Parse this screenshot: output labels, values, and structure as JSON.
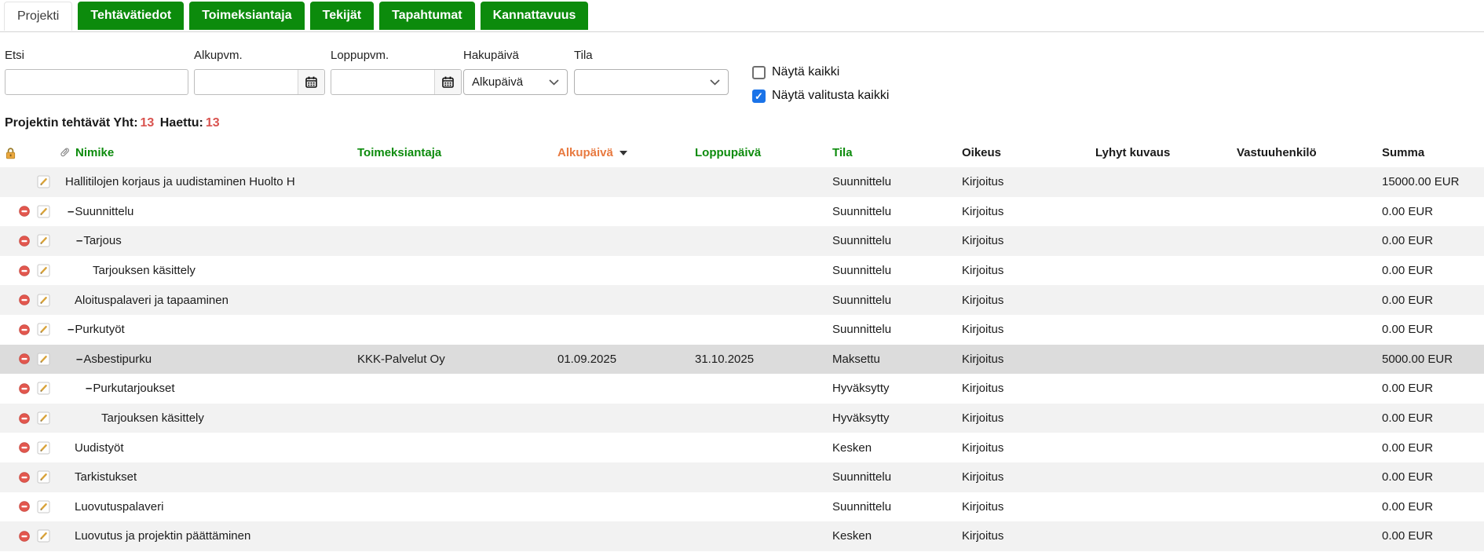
{
  "tabs": {
    "items": [
      {
        "label": "Projekti",
        "active": true
      },
      {
        "label": "Tehtävätiedot",
        "active": false
      },
      {
        "label": "Toimeksiantaja",
        "active": false
      },
      {
        "label": "Tekijät",
        "active": false
      },
      {
        "label": "Tapahtumat",
        "active": false
      },
      {
        "label": "Kannattavuus",
        "active": false
      }
    ]
  },
  "filters": {
    "etsi": {
      "label": "Etsi",
      "value": "",
      "placeholder": ""
    },
    "alkupvm": {
      "label": "Alkupvm.",
      "value": "",
      "placeholder": ""
    },
    "loppupvm": {
      "label": "Loppupvm.",
      "value": "",
      "placeholder": ""
    },
    "hakupaiva": {
      "label": "Hakupäivä",
      "selected": "Alkupäivä"
    },
    "tila": {
      "label": "Tila",
      "selected": ""
    },
    "nayta_kaikki": {
      "label": "Näytä kaikki",
      "checked": false
    },
    "nayta_valitusta_kaikki": {
      "label": "Näytä valitusta kaikki",
      "checked": true
    }
  },
  "summary": {
    "label_total": "Projektin tehtävät Yht:",
    "total": "13",
    "label_fetched": "Haettu:",
    "fetched": "13"
  },
  "table": {
    "columns": [
      {
        "key": "nimike",
        "label": "Nimike",
        "color": "#0c8b0c"
      },
      {
        "key": "toimeksiantaja",
        "label": "Toimeksiantaja",
        "color": "#0c8b0c"
      },
      {
        "key": "alkupaiva",
        "label": "Alkupäivä",
        "color": "#e8793f",
        "sort": "desc"
      },
      {
        "key": "loppupaiva",
        "label": "Loppupäivä",
        "color": "#0c8b0c"
      },
      {
        "key": "tila",
        "label": "Tila",
        "color": "#0c8b0c"
      },
      {
        "key": "oikeus",
        "label": "Oikeus",
        "color": "#1a1a1a"
      },
      {
        "key": "lyhyt_kuvaus",
        "label": "Lyhyt kuvaus",
        "color": "#1a1a1a"
      },
      {
        "key": "vastuuhenkilo",
        "label": "Vastuuhenkilö",
        "color": "#1a1a1a"
      },
      {
        "key": "summa",
        "label": "Summa",
        "color": "#1a1a1a"
      }
    ],
    "rows": [
      {
        "nimike": "Hallitilojen korjaus ja uudistaminen Huolto H",
        "level": 0,
        "has_children": false,
        "deletable": false,
        "selected": false,
        "toimeksiantaja": "",
        "alkupaiva": "",
        "loppupaiva": "",
        "tila": "Suunnittelu",
        "oikeus": "Kirjoitus",
        "lyhyt_kuvaus": "",
        "vastuuhenkilo": "",
        "summa": "15000.00 EUR"
      },
      {
        "nimike": "Suunnittelu",
        "level": 1,
        "has_children": true,
        "deletable": true,
        "selected": false,
        "toimeksiantaja": "",
        "alkupaiva": "",
        "loppupaiva": "",
        "tila": "Suunnittelu",
        "oikeus": "Kirjoitus",
        "lyhyt_kuvaus": "",
        "vastuuhenkilo": "",
        "summa": "0.00 EUR"
      },
      {
        "nimike": "Tarjous",
        "level": 2,
        "has_children": true,
        "deletable": true,
        "selected": false,
        "toimeksiantaja": "",
        "alkupaiva": "",
        "loppupaiva": "",
        "tila": "Suunnittelu",
        "oikeus": "Kirjoitus",
        "lyhyt_kuvaus": "",
        "vastuuhenkilo": "",
        "summa": "0.00 EUR"
      },
      {
        "nimike": "Tarjouksen käsittely",
        "level": 3,
        "has_children": false,
        "deletable": true,
        "selected": false,
        "toimeksiantaja": "",
        "alkupaiva": "",
        "loppupaiva": "",
        "tila": "Suunnittelu",
        "oikeus": "Kirjoitus",
        "lyhyt_kuvaus": "",
        "vastuuhenkilo": "",
        "summa": "0.00 EUR"
      },
      {
        "nimike": "Aloituspalaveri ja tapaaminen",
        "level": 1,
        "has_children": false,
        "deletable": true,
        "selected": false,
        "toimeksiantaja": "",
        "alkupaiva": "",
        "loppupaiva": "",
        "tila": "Suunnittelu",
        "oikeus": "Kirjoitus",
        "lyhyt_kuvaus": "",
        "vastuuhenkilo": "",
        "summa": "0.00 EUR"
      },
      {
        "nimike": "Purkutyöt",
        "level": 1,
        "has_children": true,
        "deletable": true,
        "selected": false,
        "toimeksiantaja": "",
        "alkupaiva": "",
        "loppupaiva": "",
        "tila": "Suunnittelu",
        "oikeus": "Kirjoitus",
        "lyhyt_kuvaus": "",
        "vastuuhenkilo": "",
        "summa": "0.00 EUR"
      },
      {
        "nimike": "Asbestipurku",
        "level": 2,
        "has_children": true,
        "deletable": true,
        "selected": true,
        "toimeksiantaja": "KKK-Palvelut Oy",
        "alkupaiva": "01.09.2025",
        "loppupaiva": "31.10.2025",
        "tila": "Maksettu",
        "oikeus": "Kirjoitus",
        "lyhyt_kuvaus": "",
        "vastuuhenkilo": "",
        "summa": "5000.00 EUR"
      },
      {
        "nimike": "Purkutarjoukset",
        "level": 3,
        "has_children": true,
        "deletable": true,
        "selected": false,
        "toimeksiantaja": "",
        "alkupaiva": "",
        "loppupaiva": "",
        "tila": "Hyväksytty",
        "oikeus": "Kirjoitus",
        "lyhyt_kuvaus": "",
        "vastuuhenkilo": "",
        "summa": "0.00 EUR"
      },
      {
        "nimike": "Tarjouksen käsittely",
        "level": 4,
        "has_children": false,
        "deletable": true,
        "selected": false,
        "toimeksiantaja": "",
        "alkupaiva": "",
        "loppupaiva": "",
        "tila": "Hyväksytty",
        "oikeus": "Kirjoitus",
        "lyhyt_kuvaus": "",
        "vastuuhenkilo": "",
        "summa": "0.00 EUR"
      },
      {
        "nimike": "Uudistyöt",
        "level": 1,
        "has_children": false,
        "deletable": true,
        "selected": false,
        "toimeksiantaja": "",
        "alkupaiva": "",
        "loppupaiva": "",
        "tila": "Kesken",
        "oikeus": "Kirjoitus",
        "lyhyt_kuvaus": "",
        "vastuuhenkilo": "",
        "summa": "0.00 EUR"
      },
      {
        "nimike": "Tarkistukset",
        "level": 1,
        "has_children": false,
        "deletable": true,
        "selected": false,
        "toimeksiantaja": "",
        "alkupaiva": "",
        "loppupaiva": "",
        "tila": "Suunnittelu",
        "oikeus": "Kirjoitus",
        "lyhyt_kuvaus": "",
        "vastuuhenkilo": "",
        "summa": "0.00 EUR"
      },
      {
        "nimike": "Luovutuspalaveri",
        "level": 1,
        "has_children": false,
        "deletable": true,
        "selected": false,
        "toimeksiantaja": "",
        "alkupaiva": "",
        "loppupaiva": "",
        "tila": "Suunnittelu",
        "oikeus": "Kirjoitus",
        "lyhyt_kuvaus": "",
        "vastuuhenkilo": "",
        "summa": "0.00 EUR"
      },
      {
        "nimike": "Luovutus ja projektin päättäminen",
        "level": 1,
        "has_children": false,
        "deletable": true,
        "selected": false,
        "toimeksiantaja": "",
        "alkupaiva": "",
        "loppupaiva": "",
        "tila": "Kesken",
        "oikeus": "Kirjoitus",
        "lyhyt_kuvaus": "",
        "vastuuhenkilo": "",
        "summa": "0.00 EUR"
      }
    ]
  },
  "icons": {
    "lock": "lock-icon",
    "attachment": "paperclip-icon",
    "delete": "delete-icon",
    "edit": "edit-pencil-icon",
    "calendar": "calendar-icon",
    "chevron": "chevron-down-icon",
    "sort": "sort-desc-arrow",
    "check": "✓",
    "collapse_glyph": "–"
  },
  "colors": {
    "tab_green": "#0c8b0c",
    "header_green": "#0c8b0c",
    "header_orange": "#e8793f",
    "summary_red": "#d9534f",
    "stripe_gray": "#f2f2f2",
    "selected_gray": "#dcdcdc",
    "checkbox_blue": "#1a73e8",
    "delete_red": "#e2574e",
    "pencil_gold": "#d9a33a",
    "lock_gold": "#eca83f"
  }
}
